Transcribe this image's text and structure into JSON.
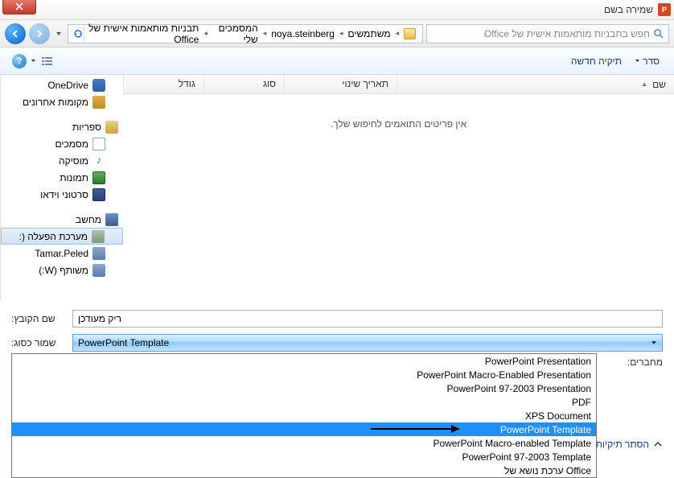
{
  "title": "שמירה בשם",
  "breadcrumb": {
    "parts": [
      "משתמשים",
      "noya.steinberg",
      "המסמכים שלי",
      "תבניות מותאמות אישית של Office"
    ]
  },
  "search": {
    "placeholder": "חפש בתבניות מותאמות אישית של Office"
  },
  "toolbar": {
    "organize": "סדר",
    "new_folder": "תיקיה חדשה"
  },
  "sidebar": {
    "items": [
      {
        "label": "OneDrive",
        "icon": "cloud-ic",
        "lvl": 1
      },
      {
        "label": "מקומות אחרונים",
        "icon": "recent-ic",
        "lvl": 1
      },
      {
        "sep": true
      },
      {
        "label": "ספריות",
        "icon": "lib-ic",
        "lvl": 0
      },
      {
        "label": "מסמכים",
        "icon": "doc-ic",
        "lvl": 1
      },
      {
        "label": "מוסיקה",
        "icon": "music-ic",
        "lvl": 1,
        "glyph": "♪"
      },
      {
        "label": "תמונות",
        "icon": "pic-ic",
        "lvl": 1
      },
      {
        "label": "סרטוני וידאו",
        "icon": "vid-ic",
        "lvl": 1
      },
      {
        "sep": true
      },
      {
        "label": "מחשב",
        "icon": "comp-ic",
        "lvl": 0
      },
      {
        "label": "מערכת הפעלה (:",
        "icon": "drive-ic",
        "lvl": 1,
        "sel": true
      },
      {
        "label": "Tamar.Peled",
        "icon": "net-ic",
        "lvl": 1
      },
      {
        "label": "משותף (W:)",
        "icon": "net-ic",
        "lvl": 1
      }
    ]
  },
  "columns": {
    "name": "שם",
    "date": "תאריך שינוי",
    "type": "סוג",
    "size": "גודל"
  },
  "empty": "אין פריטים התואמים לחיפוש שלך.",
  "form": {
    "filename_label": "שם הקובץ:",
    "filename_value": "ריק מעודכן",
    "savetype_label": "שמור כסוג:",
    "savetype_value": "PowerPoint Template",
    "authors_label": "מחברים:",
    "hide_folders": "הסתר תיקיות"
  },
  "dropdown": {
    "options": [
      "PowerPoint Presentation",
      "PowerPoint Macro-Enabled Presentation",
      "PowerPoint 97-2003 Presentation",
      "PDF",
      "XPS Document",
      "PowerPoint Template",
      "PowerPoint Macro-enabled Template",
      "PowerPoint 97-2003 Template",
      "ערכת נושא של Office"
    ],
    "selected_index": 5
  }
}
